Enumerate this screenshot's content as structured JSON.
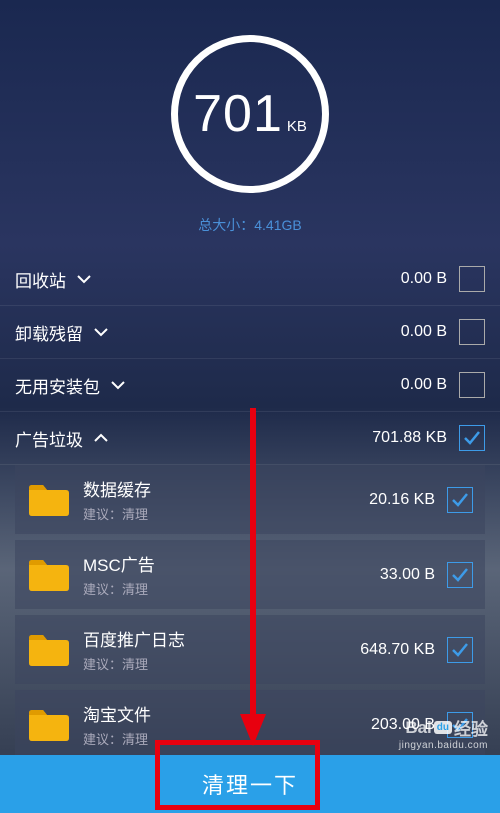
{
  "header": {
    "number": "701",
    "unit": "KB",
    "total_label": "总大小：",
    "total_value": "4.41GB"
  },
  "categories": [
    {
      "label": "回收站",
      "expanded": false,
      "size": "0.00 B",
      "checked": false
    },
    {
      "label": "卸载残留",
      "expanded": false,
      "size": "0.00 B",
      "checked": false
    },
    {
      "label": "无用安装包",
      "expanded": false,
      "size": "0.00 B",
      "checked": false
    },
    {
      "label": "广告垃圾",
      "expanded": true,
      "size": "701.88 KB",
      "checked": true
    }
  ],
  "items": [
    {
      "title": "数据缓存",
      "sug_label": "建议：",
      "sug_action": "清理",
      "size": "20.16 KB",
      "checked": true
    },
    {
      "title": "MSC广告",
      "sug_label": "建议：",
      "sug_action": "清理",
      "size": "33.00 B",
      "checked": true
    },
    {
      "title": "百度推广日志",
      "sug_label": "建议：",
      "sug_action": "清理",
      "size": "648.70 KB",
      "checked": true
    },
    {
      "title": "淘宝文件",
      "sug_label": "建议：",
      "sug_action": "清理",
      "size": "203.00 B",
      "checked": true
    }
  ],
  "bottom": {
    "label": "清理一下"
  },
  "watermark": {
    "brand_left": "Bai",
    "brand_mid": "du",
    "brand_right": "经验",
    "sub": "jingyan.baidu.com"
  }
}
